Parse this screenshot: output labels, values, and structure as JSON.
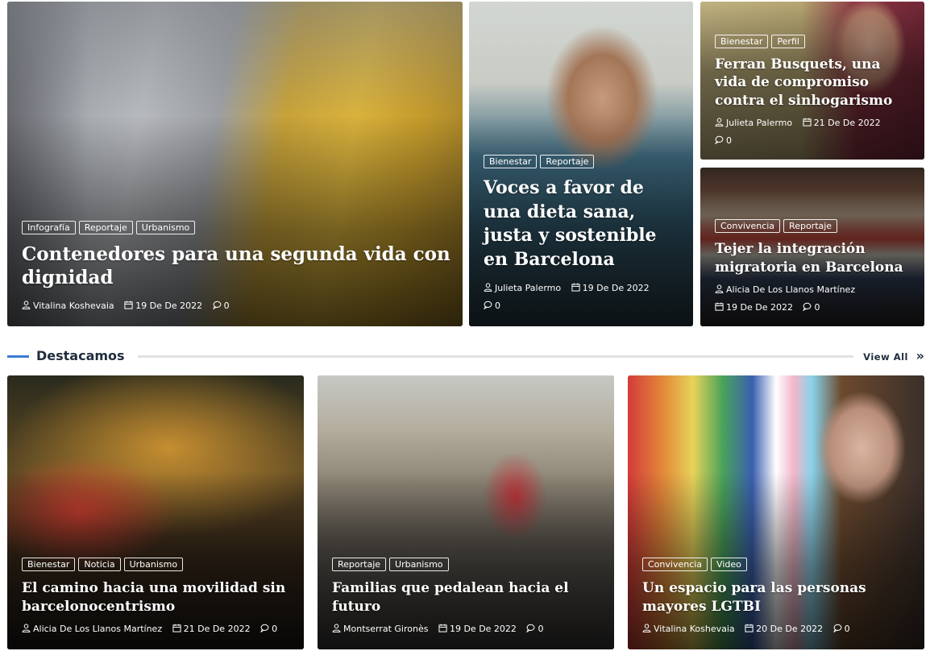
{
  "hero": [
    {
      "tags": [
        "Infografía",
        "Reportaje",
        "Urbanismo"
      ],
      "title": "Contenedores para una segunda vida con dignidad",
      "author": "Vitalina Koshevaia",
      "date": "19 De De 2022",
      "comments": "0"
    },
    {
      "tags": [
        "Bienestar",
        "Reportaje"
      ],
      "title": "Voces a favor de una dieta sana, justa y sostenible en Barcelona",
      "author": "Julieta Palermo",
      "date": "19 De De 2022",
      "comments": "0"
    },
    {
      "tags": [
        "Bienestar",
        "Perfil"
      ],
      "title": "Ferran Busquets, una vida de compromiso contra el sinhogarismo",
      "author": "Julieta Palermo",
      "date": "21 De De 2022",
      "comments": "0"
    },
    {
      "tags": [
        "Convivencia",
        "Reportaje"
      ],
      "title": "Tejer la integración migratoria en Barcelona",
      "author": "Alicia De Los Llanos Martínez",
      "date": "19 De De 2022",
      "comments": "0"
    }
  ],
  "section": {
    "title": "Destacamos",
    "view_all": "View All",
    "view_all_icon": "double-chevron-right-icon",
    "accent_color": "#3a7bd5"
  },
  "featured": [
    {
      "tags": [
        "Bienestar",
        "Noticia",
        "Urbanismo"
      ],
      "title": "El camino hacia una movilidad sin barcelonocentrismo",
      "author": "Alicia De Los Llanos Martínez",
      "date": "21 De De 2022",
      "comments": "0"
    },
    {
      "tags": [
        "Reportaje",
        "Urbanismo"
      ],
      "title": "Familias que pedalean hacia el futuro",
      "author": "Montserrat Gironès",
      "date": "19 De De 2022",
      "comments": "0"
    },
    {
      "tags": [
        "Convivencia",
        "Video"
      ],
      "title": "Un espacio para las personas mayores LGTBI",
      "author": "Vitalina Koshevaia",
      "date": "20 De De 2022",
      "comments": "0"
    }
  ]
}
